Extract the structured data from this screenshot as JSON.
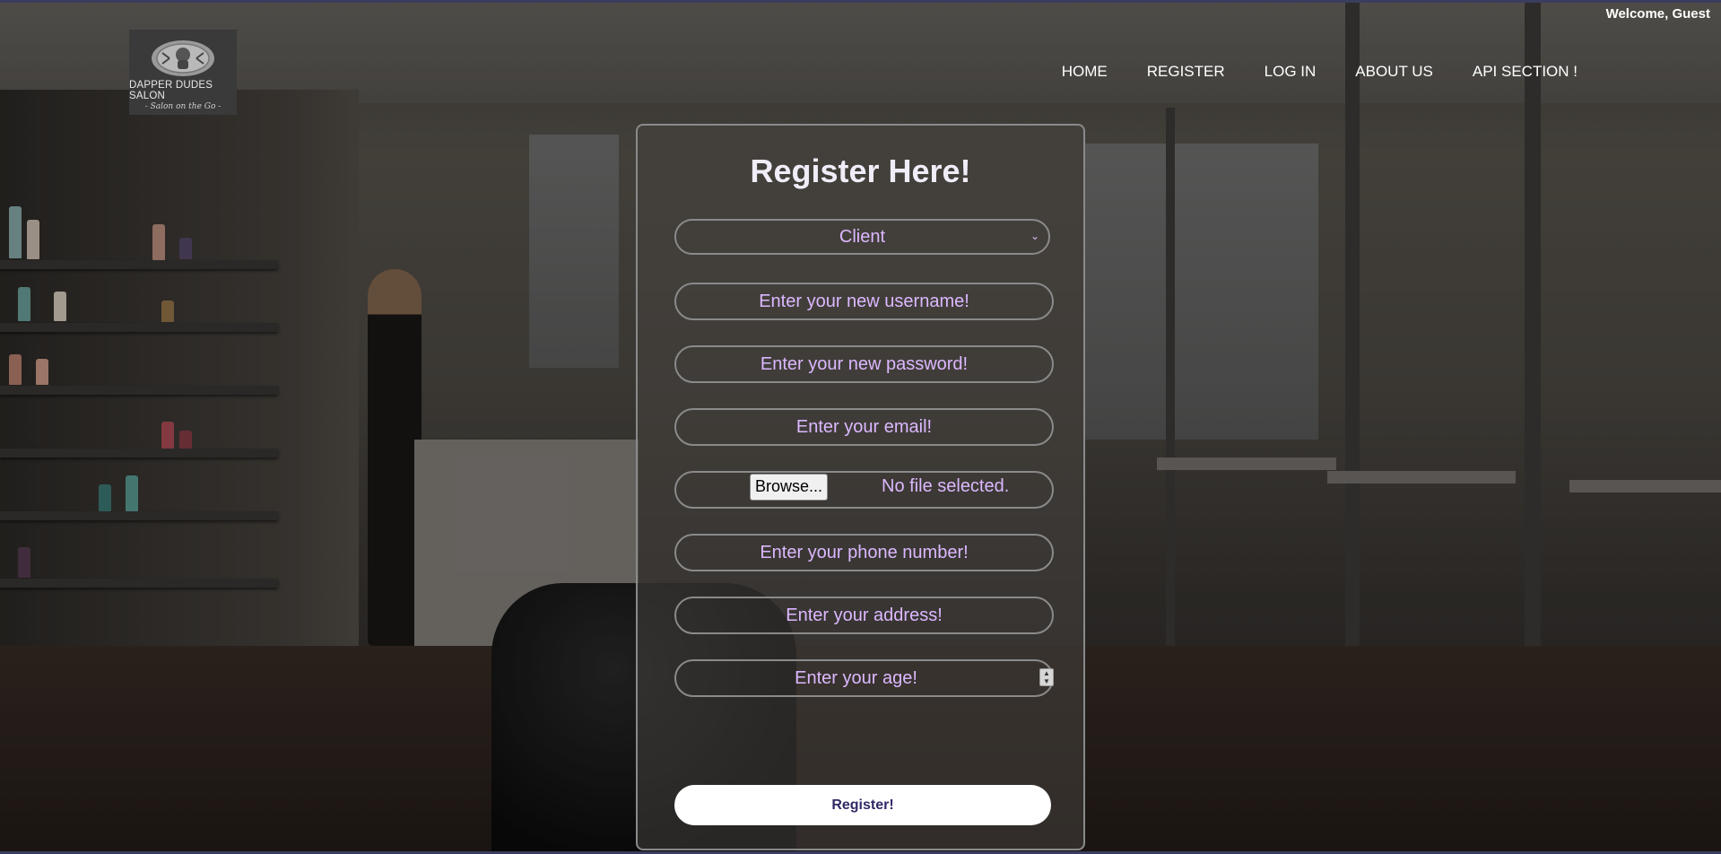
{
  "header": {
    "welcome_text": "Welcome, Guest",
    "logo": {
      "name": "DAPPER DUDES SALON",
      "tagline": "- Salon on the Go -",
      "icon": "barber-emblem-icon"
    },
    "nav": [
      {
        "label": "HOME"
      },
      {
        "label": "REGISTER"
      },
      {
        "label": "LOG IN"
      },
      {
        "label": "ABOUT US"
      },
      {
        "label": "API SECTION !"
      }
    ]
  },
  "form": {
    "title": "Register Here!",
    "role_select": {
      "value": "Client"
    },
    "username": {
      "placeholder": "Enter your new username!"
    },
    "password": {
      "placeholder": "Enter your new password!"
    },
    "email": {
      "placeholder": "Enter your email!"
    },
    "file": {
      "button_label": "Browse...",
      "status": "No file selected."
    },
    "phone": {
      "placeholder": "Enter your phone number!"
    },
    "address": {
      "placeholder": "Enter your address!"
    },
    "age": {
      "placeholder": "Enter your age!"
    },
    "submit_label": "Register!"
  },
  "colors": {
    "placeholder": "#dcb8ff",
    "submit_text": "#2f2a66",
    "accent_line": "#3a3d5e"
  }
}
